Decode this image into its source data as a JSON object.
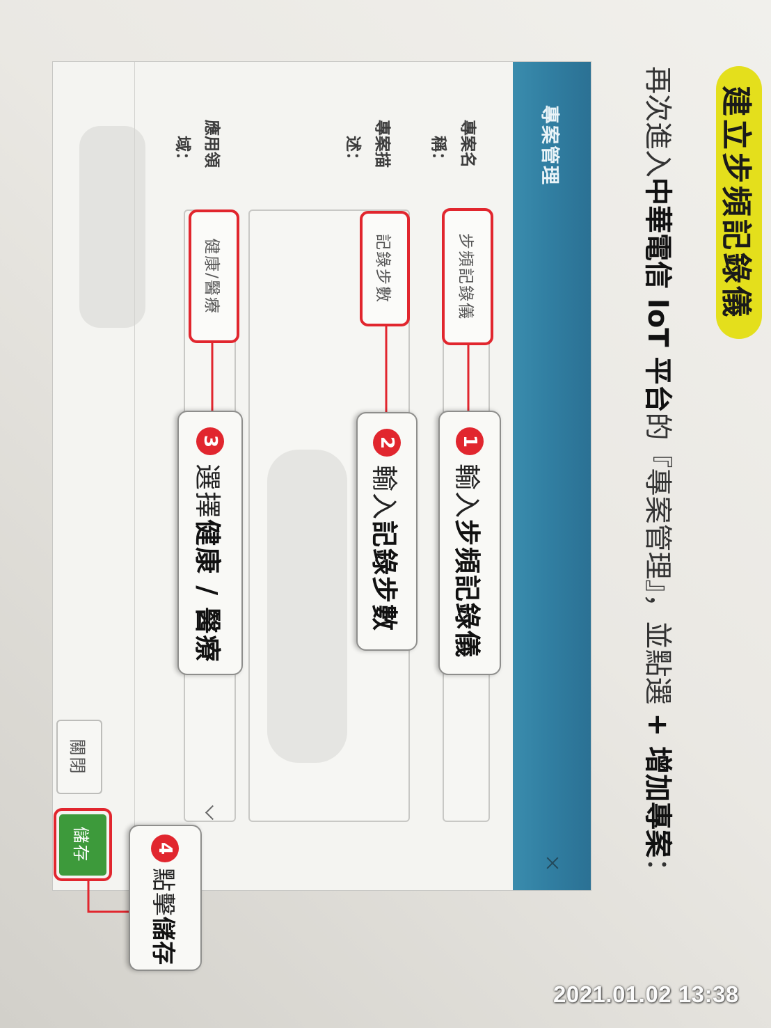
{
  "heading": "建立步頻記錄儀",
  "instruction": {
    "intro": "再次進入",
    "platform": "中華電信 IoT 平台",
    "middle": "的『專案管理』，並點選",
    "action": "+ 增加專案",
    "end": "："
  },
  "dialog": {
    "title": "專案管理",
    "close_icon": "close-icon",
    "fields": [
      {
        "label": "專案名稱：",
        "value": "步頻記錄儀"
      },
      {
        "label": "專案描述：",
        "value": "記錄步數"
      },
      {
        "label": "應用領域：",
        "value": "健康/醫療",
        "icon": "chevron-down-icon"
      }
    ],
    "buttons": {
      "close": "關閉",
      "save": "儲存"
    }
  },
  "callouts": [
    {
      "number": "1",
      "verb": "輸入",
      "target": "步頻記錄儀"
    },
    {
      "number": "2",
      "verb": "輸入",
      "target": "記錄步數"
    },
    {
      "number": "3",
      "verb": "選擇",
      "target": "健康 / 醫療"
    },
    {
      "number": "4",
      "verb": "點擊",
      "target": "儲存"
    }
  ],
  "photo_timestamp": "2021.01.02 13:38",
  "colors": {
    "heading_yellow": "#e4df1c",
    "header_teal": "#317fa2",
    "highlight_red": "#e1262e",
    "save_green": "#3d9a3b",
    "paper": "#eae8e3"
  }
}
